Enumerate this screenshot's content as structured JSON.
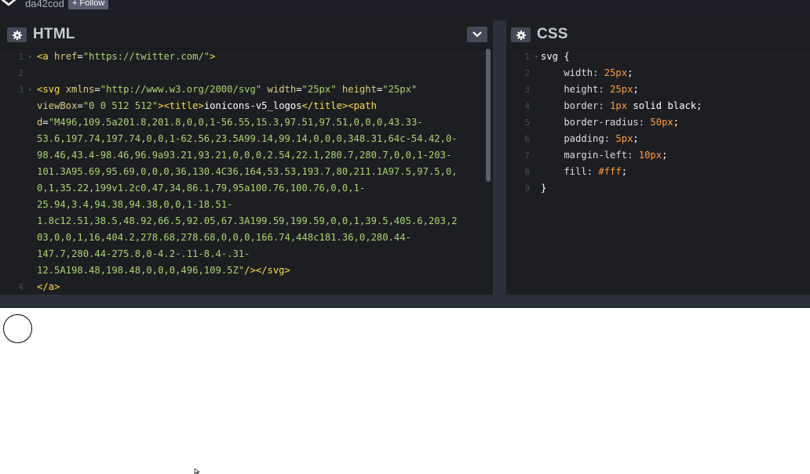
{
  "header": {
    "username": "da42cod",
    "follow_label": "+ Follow"
  },
  "html_editor": {
    "title": "HTML",
    "lines": [
      {
        "num": "1",
        "fold": true,
        "segments": [
          {
            "c": "tag",
            "t": "<a "
          },
          {
            "c": "attr",
            "t": "href"
          },
          {
            "c": "plain",
            "t": "="
          },
          {
            "c": "str",
            "t": "\"https://twitter.com/\""
          },
          {
            "c": "tag",
            "t": ">"
          }
        ]
      },
      {
        "num": "2",
        "fold": false,
        "segments": []
      },
      {
        "num": "3",
        "fold": true,
        "segments": [
          {
            "c": "tag",
            "t": "<svg "
          },
          {
            "c": "attr",
            "t": "xmlns"
          },
          {
            "c": "plain",
            "t": "="
          },
          {
            "c": "str",
            "t": "\"http://www.w3.org/2000/svg\""
          },
          {
            "c": "plain",
            "t": " "
          },
          {
            "c": "attr",
            "t": "width"
          },
          {
            "c": "plain",
            "t": "="
          },
          {
            "c": "str",
            "t": "\"25px\""
          },
          {
            "c": "plain",
            "t": " "
          },
          {
            "c": "attr",
            "t": "height"
          },
          {
            "c": "plain",
            "t": "="
          },
          {
            "c": "str",
            "t": "\"25px\""
          }
        ]
      },
      {
        "num": "",
        "fold": false,
        "segments": [
          {
            "c": "attr",
            "t": "viewBox"
          },
          {
            "c": "plain",
            "t": "="
          },
          {
            "c": "str",
            "t": "\"0 0 512 512\""
          },
          {
            "c": "tag",
            "t": "><title>"
          },
          {
            "c": "plain",
            "t": "ionicons-v5_logos"
          },
          {
            "c": "tag",
            "t": "</title><path"
          }
        ]
      },
      {
        "num": "",
        "fold": false,
        "segments": [
          {
            "c": "attr",
            "t": "d"
          },
          {
            "c": "plain",
            "t": "="
          },
          {
            "c": "str",
            "t": "\"M496,109.5a201.8,201.8,0,0,1-56.55,15.3,97.51,97.51,0,0,0,43.33-"
          }
        ]
      },
      {
        "num": "",
        "fold": false,
        "segments": [
          {
            "c": "str",
            "t": "53.6,197.74,197.74,0,0,1-62.56,23.5A99.14,99.14,0,0,0,348.31,64c-54.42,0-"
          }
        ]
      },
      {
        "num": "",
        "fold": false,
        "segments": [
          {
            "c": "str",
            "t": "98.46,43.4-98.46,96.9a93.21,93.21,0,0,0,2.54,22.1,280.7,280.7,0,0,1-203-"
          }
        ]
      },
      {
        "num": "",
        "fold": false,
        "segments": [
          {
            "c": "str",
            "t": "101.3A95.69,95.69,0,0,0,36,130.4C36,164,53.53,193.7,80,211.1A97.5,97.5,0,"
          }
        ]
      },
      {
        "num": "",
        "fold": false,
        "segments": [
          {
            "c": "str",
            "t": "0,1,35.22,199v1.2c0,47,34,86.1,79,95a100.76,100.76,0,0,1-"
          }
        ]
      },
      {
        "num": "",
        "fold": false,
        "segments": [
          {
            "c": "str",
            "t": "25.94,3.4,94.38,94.38,0,0,1-18.51-"
          }
        ]
      },
      {
        "num": "",
        "fold": false,
        "segments": [
          {
            "c": "str",
            "t": "1.8c12.51,38.5,48.92,66.5,92.05,67.3A199.59,199.59,0,0,1,39.5,405.6,203,2"
          }
        ]
      },
      {
        "num": "",
        "fold": false,
        "segments": [
          {
            "c": "str",
            "t": "03,0,0,1,16,404.2,278.68,278.68,0,0,0,166.74,448c181.36,0,280.44-"
          }
        ]
      },
      {
        "num": "",
        "fold": false,
        "segments": [
          {
            "c": "str",
            "t": "147.7,280.44-275.8,0-4.2-.11-8.4-.31-"
          }
        ]
      },
      {
        "num": "",
        "fold": false,
        "segments": [
          {
            "c": "str",
            "t": "12.5A198.48,198.48,0,0,0,496,109.5Z\""
          },
          {
            "c": "tag",
            "t": "/></svg>"
          }
        ]
      },
      {
        "num": "4",
        "fold": false,
        "segments": [
          {
            "c": "tag",
            "t": "</a>"
          }
        ]
      }
    ]
  },
  "css_editor": {
    "title": "CSS",
    "lines": [
      {
        "num": "1",
        "fold": true,
        "segments": [
          {
            "c": "sel",
            "t": "svg "
          },
          {
            "c": "plain",
            "t": "{"
          }
        ]
      },
      {
        "num": "2",
        "fold": false,
        "segments": [
          {
            "c": "prop",
            "t": "    width: "
          },
          {
            "c": "val",
            "t": "25px"
          },
          {
            "c": "plain",
            "t": ";"
          }
        ]
      },
      {
        "num": "3",
        "fold": false,
        "segments": [
          {
            "c": "prop",
            "t": "    height: "
          },
          {
            "c": "val",
            "t": "25px"
          },
          {
            "c": "plain",
            "t": ";"
          }
        ]
      },
      {
        "num": "4",
        "fold": false,
        "segments": [
          {
            "c": "prop",
            "t": "    border: "
          },
          {
            "c": "val",
            "t": "1px"
          },
          {
            "c": "plain",
            "t": " solid black;"
          }
        ]
      },
      {
        "num": "5",
        "fold": false,
        "segments": [
          {
            "c": "prop",
            "t": "    border-radius: "
          },
          {
            "c": "val",
            "t": "50px"
          },
          {
            "c": "plain",
            "t": ";"
          }
        ]
      },
      {
        "num": "6",
        "fold": false,
        "segments": [
          {
            "c": "prop",
            "t": "    padding: "
          },
          {
            "c": "val",
            "t": "5px"
          },
          {
            "c": "plain",
            "t": ";"
          }
        ]
      },
      {
        "num": "7",
        "fold": false,
        "segments": [
          {
            "c": "prop",
            "t": "    margin-left: "
          },
          {
            "c": "val",
            "t": "10px"
          },
          {
            "c": "plain",
            "t": ";"
          }
        ]
      },
      {
        "num": "8",
        "fold": false,
        "segments": [
          {
            "c": "prop",
            "t": "    fill: "
          },
          {
            "c": "val",
            "t": "#fff"
          },
          {
            "c": "plain",
            "t": ";"
          }
        ]
      },
      {
        "num": "9",
        "fold": false,
        "segments": [
          {
            "c": "plain",
            "t": "}"
          }
        ]
      }
    ]
  },
  "icons": {
    "logo": "codepen-logo-icon",
    "gear": "gear-icon",
    "collapse": "chevron-down-icon"
  }
}
